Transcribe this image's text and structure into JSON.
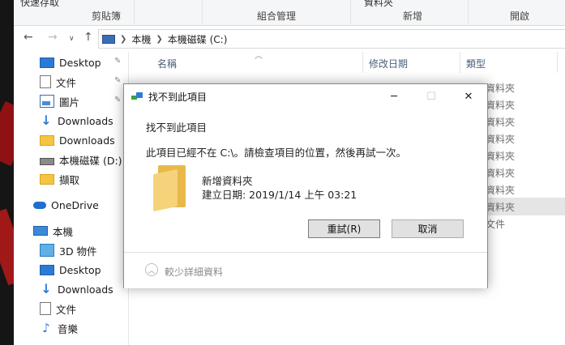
{
  "ribbon": {
    "top_text": "快速存取",
    "clipboard": "剪貼簿",
    "organize": "組合管理",
    "top_folder": "資料夾",
    "new": "新增",
    "open": "開啟"
  },
  "address": {
    "segments": [
      "本機",
      "本機磁碟 (C:)"
    ]
  },
  "nav": {
    "items": [
      {
        "label": "Desktop"
      },
      {
        "label": "文件"
      },
      {
        "label": "圖片"
      },
      {
        "label": "Downloads"
      },
      {
        "label": "Downloads"
      },
      {
        "label": "本機磁碟 (D:)"
      },
      {
        "label": "擷取"
      },
      {
        "label": "OneDrive"
      },
      {
        "label": "本機"
      },
      {
        "label": "3D 物件"
      },
      {
        "label": "Desktop"
      },
      {
        "label": "Downloads"
      },
      {
        "label": "文件"
      },
      {
        "label": "音樂"
      }
    ]
  },
  "list": {
    "columns": [
      "名稱",
      "修改日期",
      "類型"
    ],
    "types": [
      "資料夾",
      "資料夾",
      "資料夾",
      "資料夾",
      "資料夾",
      "資料夾",
      "資料夾",
      "資料夾",
      "文件"
    ]
  },
  "dialog": {
    "title": "找不到此項目",
    "heading": "找不到此項目",
    "message": "此項目已經不在 C:\\。請檢查項目的位置，然後再試一次。",
    "item_name": "新增資料夾",
    "item_date": "建立日期: 2019/1/14 上午 03:21",
    "retry": "重試(R)",
    "cancel": "取消",
    "less_details": "較少詳細資料",
    "minimize": "─",
    "maximize": "☐",
    "close": "✕"
  }
}
